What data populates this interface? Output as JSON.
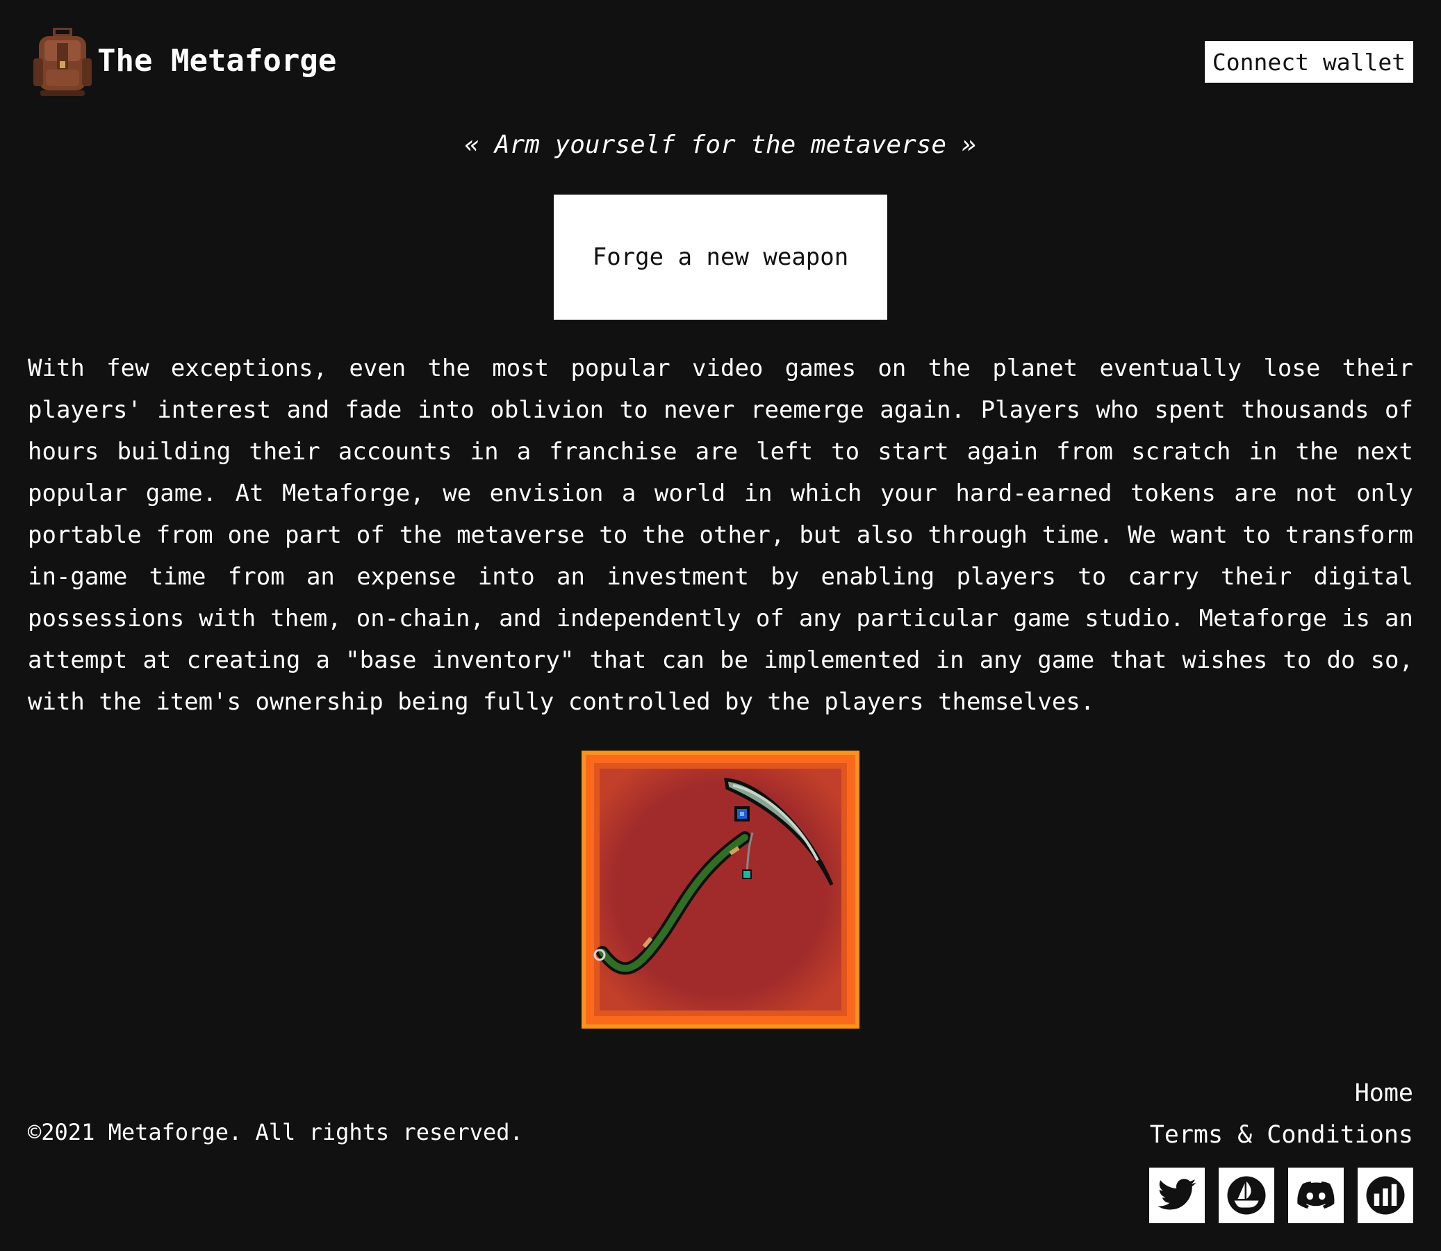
{
  "header": {
    "logo_icon": "leather-backpack-icon",
    "title": "The Metaforge",
    "connect_label": "Connect wallet"
  },
  "hero": {
    "tagline": "« Arm yourself for the metaverse »",
    "forge_label": "Forge a new weapon"
  },
  "intro": {
    "text": "With few exceptions, even the most popular video games on the planet eventually lose their players' interest and fade into oblivion to never reemerge again. Players who spent thousands of hours building their accounts in a franchise are left to start again from scratch in the next popular game. At Metaforge, we envision a world in which your hard-earned tokens are not only portable from one part of the metaverse to the other, but also through time. We want to transform in-game time from an expense into an investment by enabling players to carry their digital possessions with them, on-chain, and independently of any particular game studio. Metaforge is an attempt at creating a \"base inventory\" that can be implemented in any game that wishes to do so, with the item's ownership being fully controlled by the players themselves."
  },
  "showcase": {
    "image_icon": "pickaxe-weapon-icon",
    "frame_color": "#f7931e",
    "background_color": "#a12b2b"
  },
  "footer": {
    "copyright": "©2021 Metaforge. All rights reserved.",
    "links": [
      "Home",
      "Terms & Conditions"
    ],
    "social": [
      "twitter-icon",
      "opensea-icon",
      "discord-icon",
      "analytics-icon"
    ]
  },
  "colors": {
    "background": "#111111",
    "text": "#ffffff",
    "button_bg": "#ffffff",
    "button_text": "#111111"
  }
}
